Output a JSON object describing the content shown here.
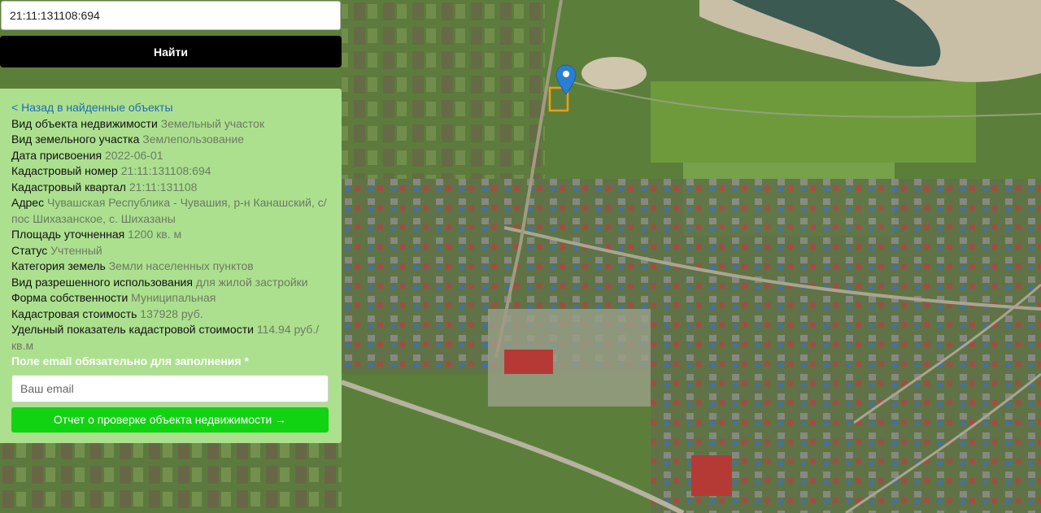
{
  "search": {
    "value": "21:11:131108:694",
    "button_label": "Найти"
  },
  "panel": {
    "back_link": "< Назад в найденные объекты",
    "fields": [
      {
        "label": "Вид объекта недвижимости",
        "value": "Земельный участок"
      },
      {
        "label": "Вид земельного участка",
        "value": "Землепользование"
      },
      {
        "label": "Дата присвоения",
        "value": "2022-06-01"
      },
      {
        "label": "Кадастровый номер",
        "value": "21:11:131108:694"
      },
      {
        "label": "Кадастровый квартал",
        "value": "21:11:131108"
      },
      {
        "label": "Адрес",
        "value": "Чувашская Республика - Чувашия, р-н Канашский, с/пос Шихазанское, с. Шихазаны"
      },
      {
        "label": "Площадь уточненная",
        "value": "1200 кв. м"
      },
      {
        "label": "Статус",
        "value": "Учтенный"
      },
      {
        "label": "Категория земель",
        "value": "Земли населенных пунктов"
      },
      {
        "label": "Вид разрешенного использования",
        "value": "для жилой застройки"
      },
      {
        "label": "Форма собственности",
        "value": "Муниципальная"
      },
      {
        "label": "Кадастровая стоимость",
        "value": "137928 руб."
      },
      {
        "label": "Удельный показатель кадастровой стоимости",
        "value": "114.94 руб./кв.м"
      }
    ],
    "email_required": "Поле email обязательно для заполнения *",
    "email_placeholder": "Ваш email",
    "report_button": "Отчет о проверке объекта недвижимости →"
  },
  "map": {
    "marker_icon": "map-pin-icon",
    "marker_color": "#2a7fd4",
    "parcel_color": "#f39c12"
  },
  "colors": {
    "panel_bg": "#ace08f",
    "report_button_bg": "#12d312",
    "search_button_bg": "#000000"
  }
}
